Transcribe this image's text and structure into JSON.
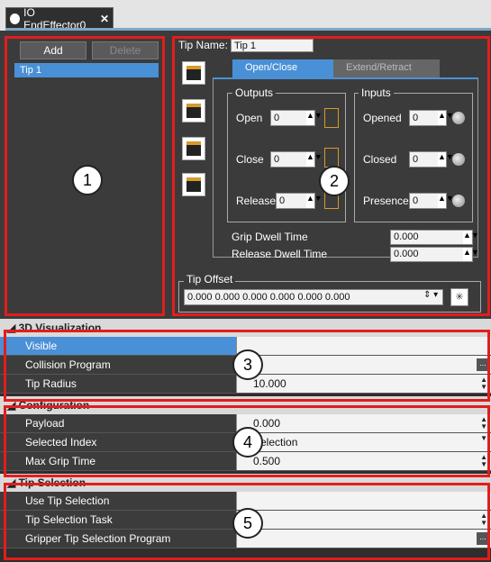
{
  "window": {
    "tab_title": "IO EndEffector0",
    "tab_close": "✕"
  },
  "tips_panel": {
    "add_label": "Add",
    "delete_label": "Delete",
    "items": [
      "Tip 1"
    ]
  },
  "tip_name": {
    "label": "Tip Name:",
    "value": "Tip 1"
  },
  "io_tabs": {
    "open_close": "Open/Close",
    "extend_retract": "Extend/Retract"
  },
  "outputs": {
    "title": "Outputs",
    "rows": [
      {
        "label": "Open",
        "value": "0"
      },
      {
        "label": "Close",
        "value": "0"
      },
      {
        "label": "Release",
        "value": "0"
      }
    ]
  },
  "inputs": {
    "title": "Inputs",
    "rows": [
      {
        "label": "Opened",
        "value": "0"
      },
      {
        "label": "Closed",
        "value": "0"
      },
      {
        "label": "Presence",
        "value": "0"
      }
    ]
  },
  "dwell": {
    "grip_label": "Grip Dwell Time",
    "grip_value": "0.000",
    "release_label": "Release Dwell Time",
    "release_value": "0.000"
  },
  "tip_offset": {
    "label": "Tip Offset",
    "value": "0.000 0.000 0.000 0.000 0.000 0.000"
  },
  "callouts": [
    "1",
    "2",
    "3",
    "4",
    "5"
  ],
  "properties": {
    "viz": {
      "title": "3D Visualization",
      "rows": [
        {
          "name": "Visible",
          "value": ""
        },
        {
          "name": "Collision Program",
          "value": ""
        },
        {
          "name": "Tip Radius",
          "value": "10.000"
        }
      ]
    },
    "config": {
      "title": "Configuration",
      "rows": [
        {
          "name": "Payload",
          "value": "0.000"
        },
        {
          "name": "Selected Index",
          "value": "Selection"
        },
        {
          "name": "Max Grip Time",
          "value": "0.500"
        }
      ]
    },
    "tipsel": {
      "title": "Tip Selection",
      "rows": [
        {
          "name": "Use Tip Selection",
          "value": ""
        },
        {
          "name": "Tip Selection Task",
          "value": ""
        },
        {
          "name": "Gripper Tip Selection Program",
          "value": ""
        }
      ]
    }
  },
  "colors": {
    "accent": "#4a90d6",
    "highlight": "#e21d1d",
    "toolbar": "#d59b2b"
  }
}
